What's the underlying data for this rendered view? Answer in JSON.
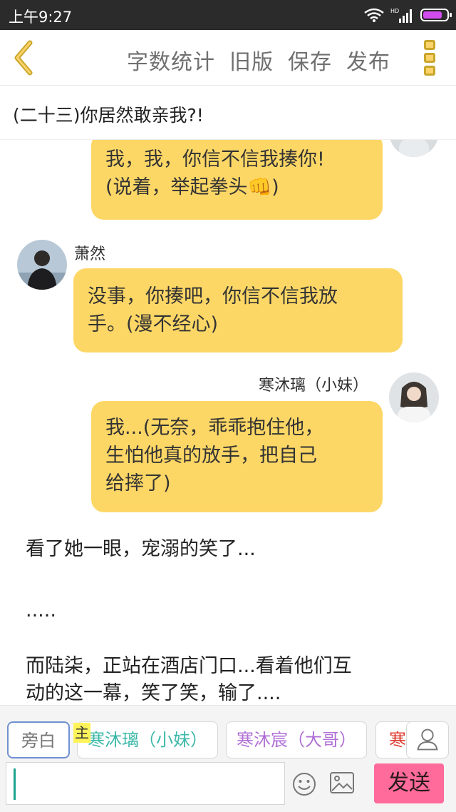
{
  "status_bar": {
    "time": "上午9:27",
    "battery_color": "#d24cf0"
  },
  "toolbar": {
    "back_icon": "chevron-left-icon",
    "actions": [
      "字数统计",
      "旧版",
      "保存",
      "发布"
    ],
    "more_icon": "more-vertical-icon"
  },
  "chapter": {
    "title": "(二十三)你居然敢亲我?!"
  },
  "messages": [
    {
      "side": "right",
      "sender": "",
      "lines": [
        "我，我，你信不信我揍你!",
        "(说着，举起拳头👊)"
      ]
    },
    {
      "side": "left",
      "sender": "萧然",
      "lines": [
        "没事，你揍吧，你信不信我放",
        "手。(漫不经心)"
      ]
    },
    {
      "side": "right",
      "sender": "寒沐璃（小妹）",
      "lines": [
        "我...(无奈，乖乖抱住他，",
        "生怕他真的放手，把自己",
        "给摔了)"
      ]
    }
  ],
  "narration": {
    "line1": "看了她一眼，宠溺的笑了...",
    "line2": ".....",
    "line3a": "而陆柒，正站在酒店门口...看着他们互",
    "line3b": "动的这一幕，笑了笑，输了...."
  },
  "characters": {
    "narrator": "旁白",
    "main_tag": "主",
    "items": [
      {
        "name": "寒沐璃（小妹）",
        "color": "#3bb8a8"
      },
      {
        "name": "寒沐宸（大哥）",
        "color": "#b06fd6"
      },
      {
        "name": "寒",
        "color": "#e0392e"
      }
    ]
  },
  "input": {
    "placeholder": "",
    "send_label": "发送",
    "send_color": "#ff6b9a"
  },
  "bubble_color": "#fdd766"
}
